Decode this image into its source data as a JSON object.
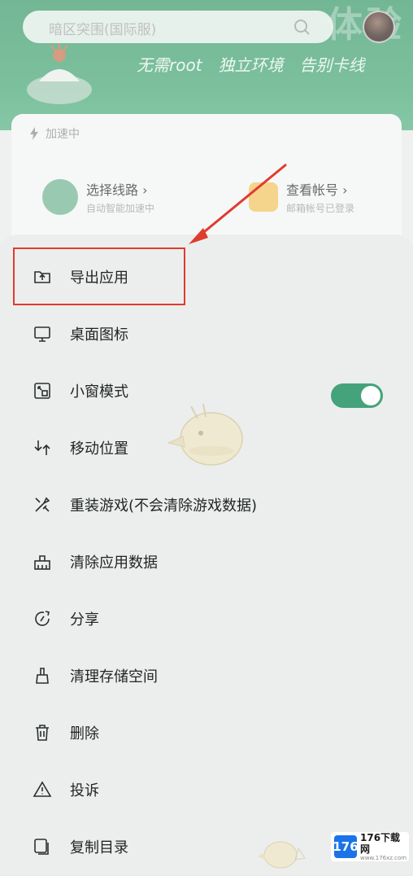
{
  "header": {
    "title_partial": "体验",
    "search_placeholder": "暗区突围(国际服)",
    "slogans": [
      "无需root",
      "独立环境",
      "告别卡线"
    ]
  },
  "card": {
    "status": "加速中",
    "features": [
      {
        "title": "选择线路",
        "subtitle": "自动智能加速中"
      },
      {
        "title": "查看帐号",
        "subtitle": "邮箱帐号已登录"
      }
    ]
  },
  "menu": {
    "items": [
      {
        "label": "导出应用",
        "icon": "export-icon"
      },
      {
        "label": "桌面图标",
        "icon": "desktop-icon"
      },
      {
        "label": "小窗模式",
        "icon": "float-window-icon"
      },
      {
        "label": "移动位置",
        "icon": "move-icon"
      },
      {
        "label": "重装游戏(不会清除游戏数据)",
        "icon": "reinstall-icon"
      },
      {
        "label": "清除应用数据",
        "icon": "clear-data-icon"
      },
      {
        "label": "分享",
        "icon": "share-icon"
      },
      {
        "label": "清理存储空间",
        "icon": "clean-storage-icon"
      },
      {
        "label": "删除",
        "icon": "trash-icon"
      },
      {
        "label": "投诉",
        "icon": "warning-icon"
      },
      {
        "label": "复制目录",
        "icon": "copy-icon"
      }
    ],
    "float_window_enabled": true
  },
  "watermark": {
    "badge": "176",
    "name": "176下载网",
    "url": "www.176xz.com"
  },
  "colors": {
    "accent_green": "#44a37a",
    "highlight_red": "#e03b2f",
    "header_green": "#3d9a6c"
  }
}
